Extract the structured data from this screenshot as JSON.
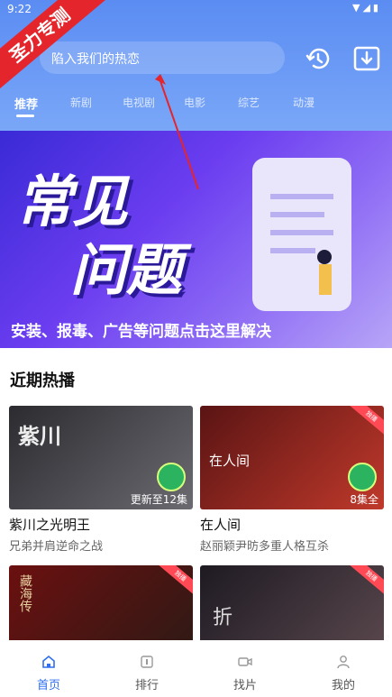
{
  "status_bar": {
    "time": "9:22",
    "icons": "▼◢▮"
  },
  "ribbon": {
    "text": "圣力专测"
  },
  "search": {
    "placeholder": "陷入我们的热恋"
  },
  "tabs": [
    {
      "label": "推荐",
      "active": true
    },
    {
      "label": "新剧"
    },
    {
      "label": "电视剧"
    },
    {
      "label": "电影"
    },
    {
      "label": "综艺"
    },
    {
      "label": "动漫"
    }
  ],
  "banner": {
    "headline_1": "常见",
    "headline_2": "问题",
    "caption": "安装、报毒、广告等问题点击这里解决",
    "dots": 6,
    "active_dot": 0
  },
  "section": {
    "title": "近期热播"
  },
  "cards": [
    {
      "title": "紫川之光明王",
      "subtitle": "兄弟并肩逆命之战",
      "episodes": "更新至12集",
      "poster_text": "紫川",
      "colors": [
        "#2b2b30",
        "#6a6a70"
      ]
    },
    {
      "title": "在人间",
      "subtitle": "赵丽颖尹昉多重人格互杀",
      "episodes": "8集全",
      "poster_text": "在人间",
      "corner": "独播",
      "colors": [
        "#5a1414",
        "#c0392b"
      ]
    },
    {
      "title": "",
      "subtitle": "",
      "episodes": "",
      "poster_text": "藏海传",
      "corner": "独播",
      "colors": [
        "#6b1010",
        "#2b1a15"
      ]
    },
    {
      "title": "",
      "subtitle": "",
      "episodes": "",
      "poster_text": "折",
      "corner": "独播",
      "colors": [
        "#1e1a22",
        "#5d4a50"
      ]
    }
  ],
  "bottom_nav": [
    {
      "label": "首页",
      "icon": "home-icon",
      "active": true
    },
    {
      "label": "排行",
      "icon": "ranking-icon"
    },
    {
      "label": "找片",
      "icon": "video-camera-icon"
    },
    {
      "label": "我的",
      "icon": "user-icon"
    }
  ],
  "colors": {
    "accent": "#2f6ff0",
    "header": "#6d9cf6",
    "ribbon": "#e4252b"
  }
}
